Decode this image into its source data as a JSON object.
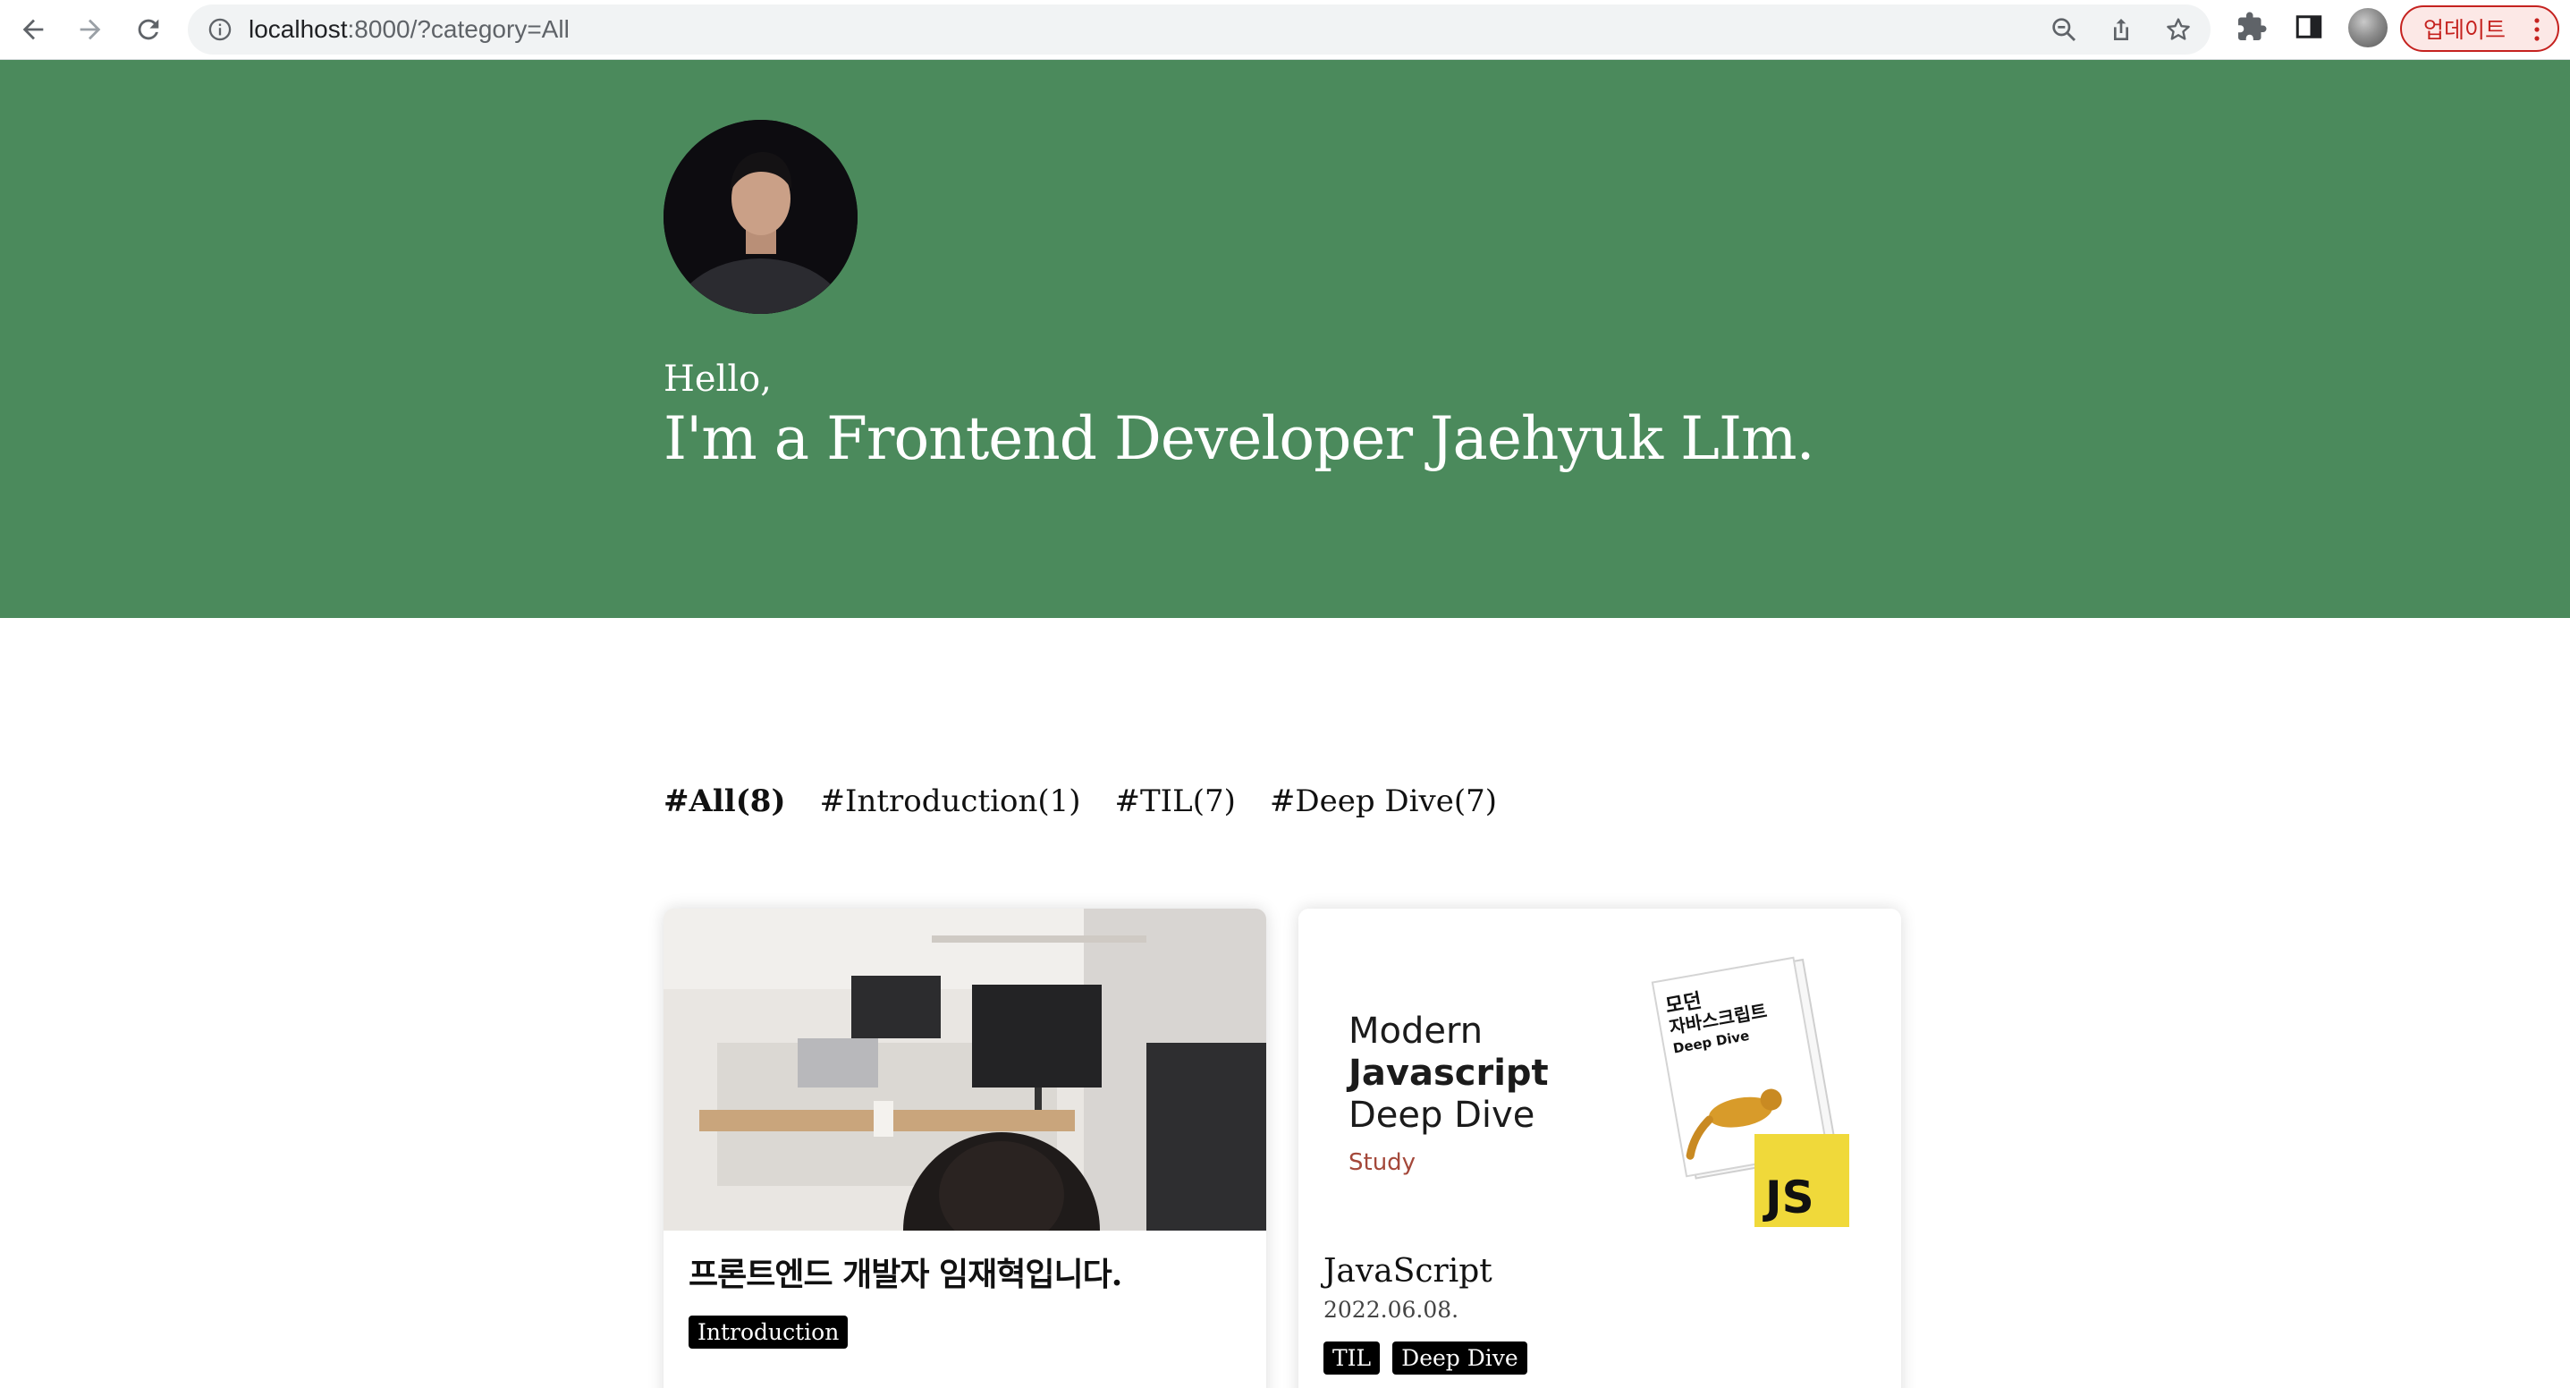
{
  "browser": {
    "url_host": "localhost",
    "url_path": ":8000/?category=All",
    "update_label": "업데이트"
  },
  "hero": {
    "greeting": "Hello,",
    "title": "I'm a Frontend Developer Jaehyuk LIm.",
    "background_color": "#4b8a5c"
  },
  "categories": [
    {
      "label": "#All(8)",
      "active": true
    },
    {
      "label": "#Introduction(1)",
      "active": false
    },
    {
      "label": "#TIL(7)",
      "active": false
    },
    {
      "label": "#Deep Dive(7)",
      "active": false
    }
  ],
  "posts": [
    {
      "title": "프론트엔드 개발자 임재혁입니다.",
      "date": "",
      "tags": [
        "Introduction"
      ]
    },
    {
      "title": "JavaScript",
      "date": "2022.06.08.",
      "tags": [
        "TIL",
        "Deep Dive"
      ],
      "thumbnail": {
        "line1": "Modern",
        "line2": "Javascript",
        "line3": "Deep Dive",
        "subtitle": "Study",
        "book_title_1": "모던",
        "book_title_2": "자바스크립트",
        "book_title_3": "Deep Dive",
        "badge": "JS"
      }
    }
  ]
}
